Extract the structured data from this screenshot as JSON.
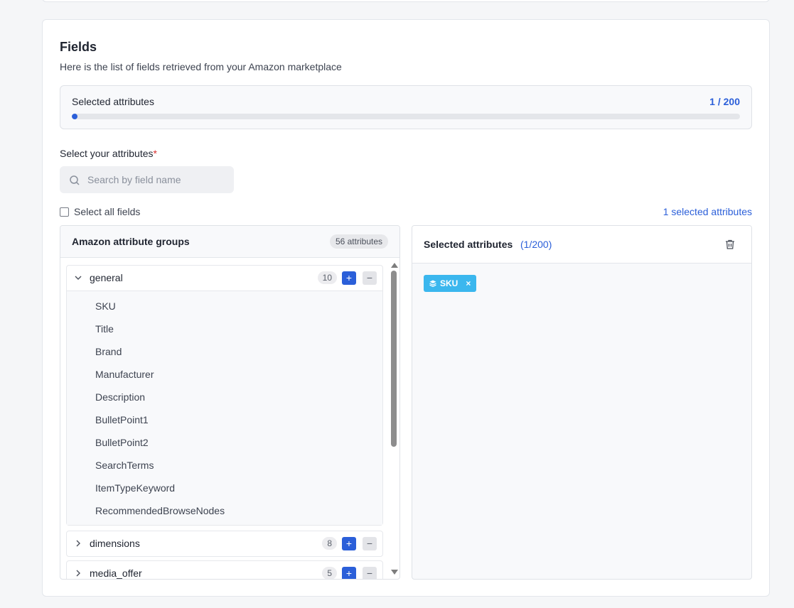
{
  "fields": {
    "title": "Fields",
    "subtitle": "Here is the list of fields retrieved from your Amazon marketplace"
  },
  "progress": {
    "label": "Selected attributes",
    "count_text": "1 / 200",
    "fraction": 0.005
  },
  "select": {
    "label": "Select your attributes",
    "required_mark": "*",
    "search_placeholder": "Search by field name",
    "select_all_label": "Select all fields",
    "selected_link": "1 selected attributes"
  },
  "left_panel": {
    "title": "Amazon attribute groups",
    "badge": "56 attributes",
    "groups": [
      {
        "name": "general",
        "count": "10",
        "expanded": true,
        "items": [
          "SKU",
          "Title",
          "Brand",
          "Manufacturer",
          "Description",
          "BulletPoint1",
          "BulletPoint2",
          "SearchTerms",
          "ItemTypeKeyword",
          "RecommendedBrowseNodes"
        ]
      },
      {
        "name": "dimensions",
        "count": "8",
        "expanded": false
      },
      {
        "name": "media_offer",
        "count": "5",
        "expanded": false
      }
    ],
    "plus_label": "+",
    "minus_label": "−"
  },
  "right_panel": {
    "title": "Selected attributes",
    "count": "(1/200)",
    "chips": [
      {
        "label": "SKU",
        "close": "×"
      }
    ]
  },
  "colors": {
    "accent": "#2b5fd9",
    "chip": "#3bb7ee",
    "required": "#d93030"
  },
  "icons": {
    "search": "search-icon",
    "trash": "trash-icon",
    "chevron_down": "chevron-down-icon",
    "chevron_right": "chevron-right-icon",
    "chip": "layers-icon"
  }
}
